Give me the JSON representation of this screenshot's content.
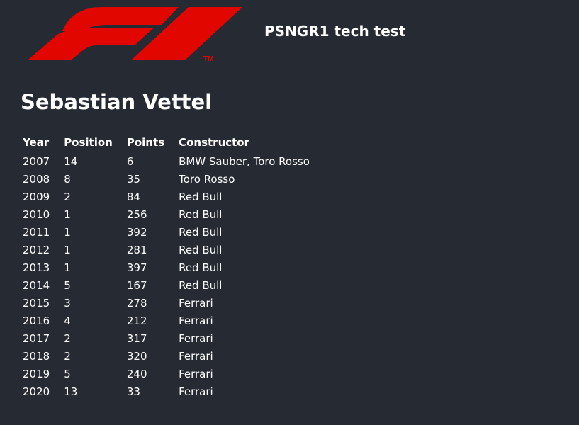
{
  "header": {
    "logo_icon": "f1-logo-icon",
    "logo_color": "#e10600",
    "trademark": "TM",
    "title": "PSNGR1 tech test"
  },
  "driver": {
    "name": "Sebastian Vettel"
  },
  "table": {
    "columns": [
      "Year",
      "Position",
      "Points",
      "Constructor"
    ],
    "rows": [
      {
        "year": "2007",
        "position": "14",
        "points": "6",
        "constructor": "BMW Sauber, Toro Rosso"
      },
      {
        "year": "2008",
        "position": "8",
        "points": "35",
        "constructor": "Toro Rosso"
      },
      {
        "year": "2009",
        "position": "2",
        "points": "84",
        "constructor": "Red Bull"
      },
      {
        "year": "2010",
        "position": "1",
        "points": "256",
        "constructor": "Red Bull"
      },
      {
        "year": "2011",
        "position": "1",
        "points": "392",
        "constructor": "Red Bull"
      },
      {
        "year": "2012",
        "position": "1",
        "points": "281",
        "constructor": "Red Bull"
      },
      {
        "year": "2013",
        "position": "1",
        "points": "397",
        "constructor": "Red Bull"
      },
      {
        "year": "2014",
        "position": "5",
        "points": "167",
        "constructor": "Red Bull"
      },
      {
        "year": "2015",
        "position": "3",
        "points": "278",
        "constructor": "Ferrari"
      },
      {
        "year": "2016",
        "position": "4",
        "points": "212",
        "constructor": "Ferrari"
      },
      {
        "year": "2017",
        "position": "2",
        "points": "317",
        "constructor": "Ferrari"
      },
      {
        "year": "2018",
        "position": "2",
        "points": "320",
        "constructor": "Ferrari"
      },
      {
        "year": "2019",
        "position": "5",
        "points": "240",
        "constructor": "Ferrari"
      },
      {
        "year": "2020",
        "position": "13",
        "points": "33",
        "constructor": "Ferrari"
      }
    ]
  }
}
